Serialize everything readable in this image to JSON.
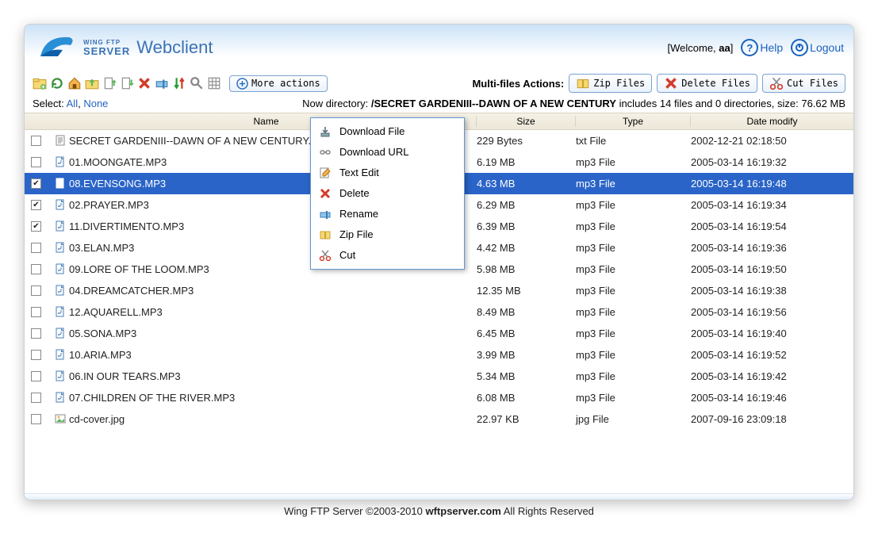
{
  "header": {
    "logo_top": "WING FTP",
    "logo_bottom": "SERVER",
    "title": "Webclient",
    "welcome_prefix": "[Welcome, ",
    "welcome_user": "aa",
    "welcome_suffix": "]",
    "help": "Help",
    "logout": "Logout"
  },
  "toolbar": {
    "more_actions": "More actions",
    "multi_label": "Multi-files Actions:",
    "zip_btn": "Zip Files",
    "delete_btn": "Delete Files",
    "cut_btn": "Cut Files"
  },
  "dirline": {
    "select_label": "Select: ",
    "select_all": "All",
    "select_sep": ", ",
    "select_none": "None",
    "now_dir_label": "Now directory: ",
    "path": "/SECRET GARDENIII--DAWN OF A NEW CENTURY",
    "includes": "   includes 14 files and 0 directories, size: 76.62 MB"
  },
  "columns": {
    "name": "Name",
    "size": "Size",
    "type": "Type",
    "date": "Date modify"
  },
  "files": [
    {
      "checked": false,
      "selected": false,
      "icon": "text",
      "name": "SECRET GARDENIII--DAWN OF A NEW CENTURY.txt",
      "size": "229 Bytes",
      "type": "txt File",
      "date": "2002-12-21 02:18:50"
    },
    {
      "checked": false,
      "selected": false,
      "icon": "mp3",
      "name": "01.MOONGATE.MP3",
      "size": "6.19 MB",
      "type": "mp3 File",
      "date": "2005-03-14 16:19:32"
    },
    {
      "checked": true,
      "selected": true,
      "icon": "mp3",
      "name": "08.EVENSONG.MP3",
      "size": "4.63 MB",
      "type": "mp3 File",
      "date": "2005-03-14 16:19:48"
    },
    {
      "checked": true,
      "selected": false,
      "icon": "mp3",
      "name": "02.PRAYER.MP3",
      "size": "6.29 MB",
      "type": "mp3 File",
      "date": "2005-03-14 16:19:34"
    },
    {
      "checked": true,
      "selected": false,
      "icon": "mp3",
      "name": "11.DIVERTIMENTO.MP3",
      "size": "6.39 MB",
      "type": "mp3 File",
      "date": "2005-03-14 16:19:54"
    },
    {
      "checked": false,
      "selected": false,
      "icon": "mp3",
      "name": "03.ELAN.MP3",
      "size": "4.42 MB",
      "type": "mp3 File",
      "date": "2005-03-14 16:19:36"
    },
    {
      "checked": false,
      "selected": false,
      "icon": "mp3",
      "name": "09.LORE OF THE LOOM.MP3",
      "size": "5.98 MB",
      "type": "mp3 File",
      "date": "2005-03-14 16:19:50"
    },
    {
      "checked": false,
      "selected": false,
      "icon": "mp3",
      "name": "04.DREAMCATCHER.MP3",
      "size": "12.35 MB",
      "type": "mp3 File",
      "date": "2005-03-14 16:19:38"
    },
    {
      "checked": false,
      "selected": false,
      "icon": "mp3",
      "name": "12.AQUARELL.MP3",
      "size": "8.49 MB",
      "type": "mp3 File",
      "date": "2005-03-14 16:19:56"
    },
    {
      "checked": false,
      "selected": false,
      "icon": "mp3",
      "name": "05.SONA.MP3",
      "size": "6.45 MB",
      "type": "mp3 File",
      "date": "2005-03-14 16:19:40"
    },
    {
      "checked": false,
      "selected": false,
      "icon": "mp3",
      "name": "10.ARIA.MP3",
      "size": "3.99 MB",
      "type": "mp3 File",
      "date": "2005-03-14 16:19:52"
    },
    {
      "checked": false,
      "selected": false,
      "icon": "mp3",
      "name": "06.IN OUR TEARS.MP3",
      "size": "5.34 MB",
      "type": "mp3 File",
      "date": "2005-03-14 16:19:42"
    },
    {
      "checked": false,
      "selected": false,
      "icon": "mp3",
      "name": "07.CHILDREN OF THE RIVER.MP3",
      "size": "6.08 MB",
      "type": "mp3 File",
      "date": "2005-03-14 16:19:46"
    },
    {
      "checked": false,
      "selected": false,
      "icon": "jpg",
      "name": "cd-cover.jpg",
      "size": "22.97 KB",
      "type": "jpg File",
      "date": "2007-09-16 23:09:18"
    }
  ],
  "context_menu": [
    {
      "icon": "download",
      "label": "Download File"
    },
    {
      "icon": "link",
      "label": "Download URL"
    },
    {
      "icon": "edit",
      "label": "Text Edit"
    },
    {
      "icon": "delete",
      "label": "Delete"
    },
    {
      "icon": "rename",
      "label": "Rename"
    },
    {
      "icon": "zip",
      "label": "Zip File"
    },
    {
      "icon": "cut",
      "label": "Cut"
    }
  ],
  "footer": {
    "left": "Wing FTP Server ©2003-2010 ",
    "site": "wftpserver.com",
    "right": " All Rights Reserved"
  }
}
